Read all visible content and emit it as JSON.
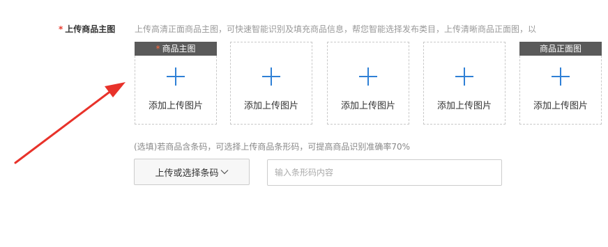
{
  "main_image_row": {
    "label_star": "*",
    "label": "上传商品主图",
    "hint": "上传高清正面商品主图，可快速智能识别及填充商品信息，帮您智能选择发布类目，上传清晰商品正面图，以"
  },
  "slots": [
    {
      "tag_star": "*",
      "tag": "商品主图",
      "label": "添加上传图片"
    },
    {
      "label": "添加上传图片"
    },
    {
      "label": "添加上传图片"
    },
    {
      "label": "添加上传图片"
    },
    {
      "tag": "商品正面图",
      "label": "添加上传图片"
    }
  ],
  "barcode": {
    "hint": "(选填)若商品含条码，可选择上传商品条形码，可提高商品识别准确率70%",
    "button_label": "上传或选择条码",
    "input_placeholder": "输入条形码内容",
    "input_value": ""
  },
  "annotation": {
    "arrow_color": "#e8322a"
  }
}
